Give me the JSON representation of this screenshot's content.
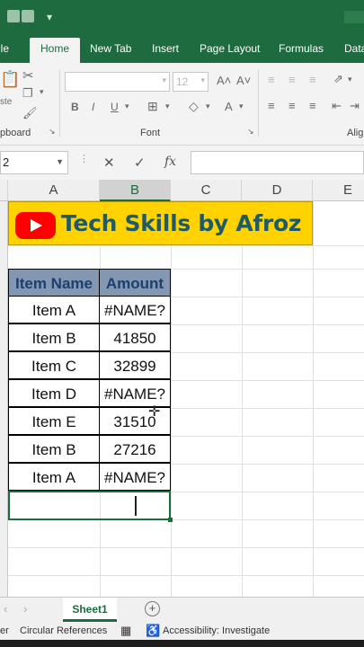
{
  "ribbon": {
    "tabs": [
      {
        "label": "ile",
        "active": false
      },
      {
        "label": "Home",
        "active": true
      },
      {
        "label": "New Tab",
        "active": false
      },
      {
        "label": "Insert",
        "active": false
      },
      {
        "label": "Page Layout",
        "active": false
      },
      {
        "label": "Formulas",
        "active": false
      },
      {
        "label": "Data",
        "active": false
      }
    ],
    "font_size": "12",
    "groups": {
      "clipboard": "pboard",
      "font": "Font",
      "alignment": "Alig"
    },
    "paste_label": "ste"
  },
  "formula_bar": {
    "name_box": "2",
    "formula": ""
  },
  "columns": [
    "A",
    "B",
    "C",
    "D",
    "E"
  ],
  "selected_column": "B",
  "banner": {
    "title": "Tech Skills by Afroz",
    "bg_color": "#ffd200",
    "text_color": "#1f5a66"
  },
  "table": {
    "headers": [
      "Item Name",
      "Amount"
    ],
    "rows": [
      [
        "Item A",
        "#NAME?"
      ],
      [
        "Item B",
        "41850"
      ],
      [
        "Item C",
        "32899"
      ],
      [
        "Item D",
        "#NAME?"
      ],
      [
        "Item E",
        "31510"
      ],
      [
        "Item B",
        "27216"
      ],
      [
        "Item A",
        "#NAME?"
      ]
    ]
  },
  "sheets": [
    "Sheet1"
  ],
  "status": {
    "left": "er",
    "circular": "Circular References",
    "accessibility": "Accessibility: Investigate"
  },
  "colors": {
    "accent": "#1d6b3e",
    "header_fill": "#8497b0",
    "header_text": "#1c3f6e"
  }
}
